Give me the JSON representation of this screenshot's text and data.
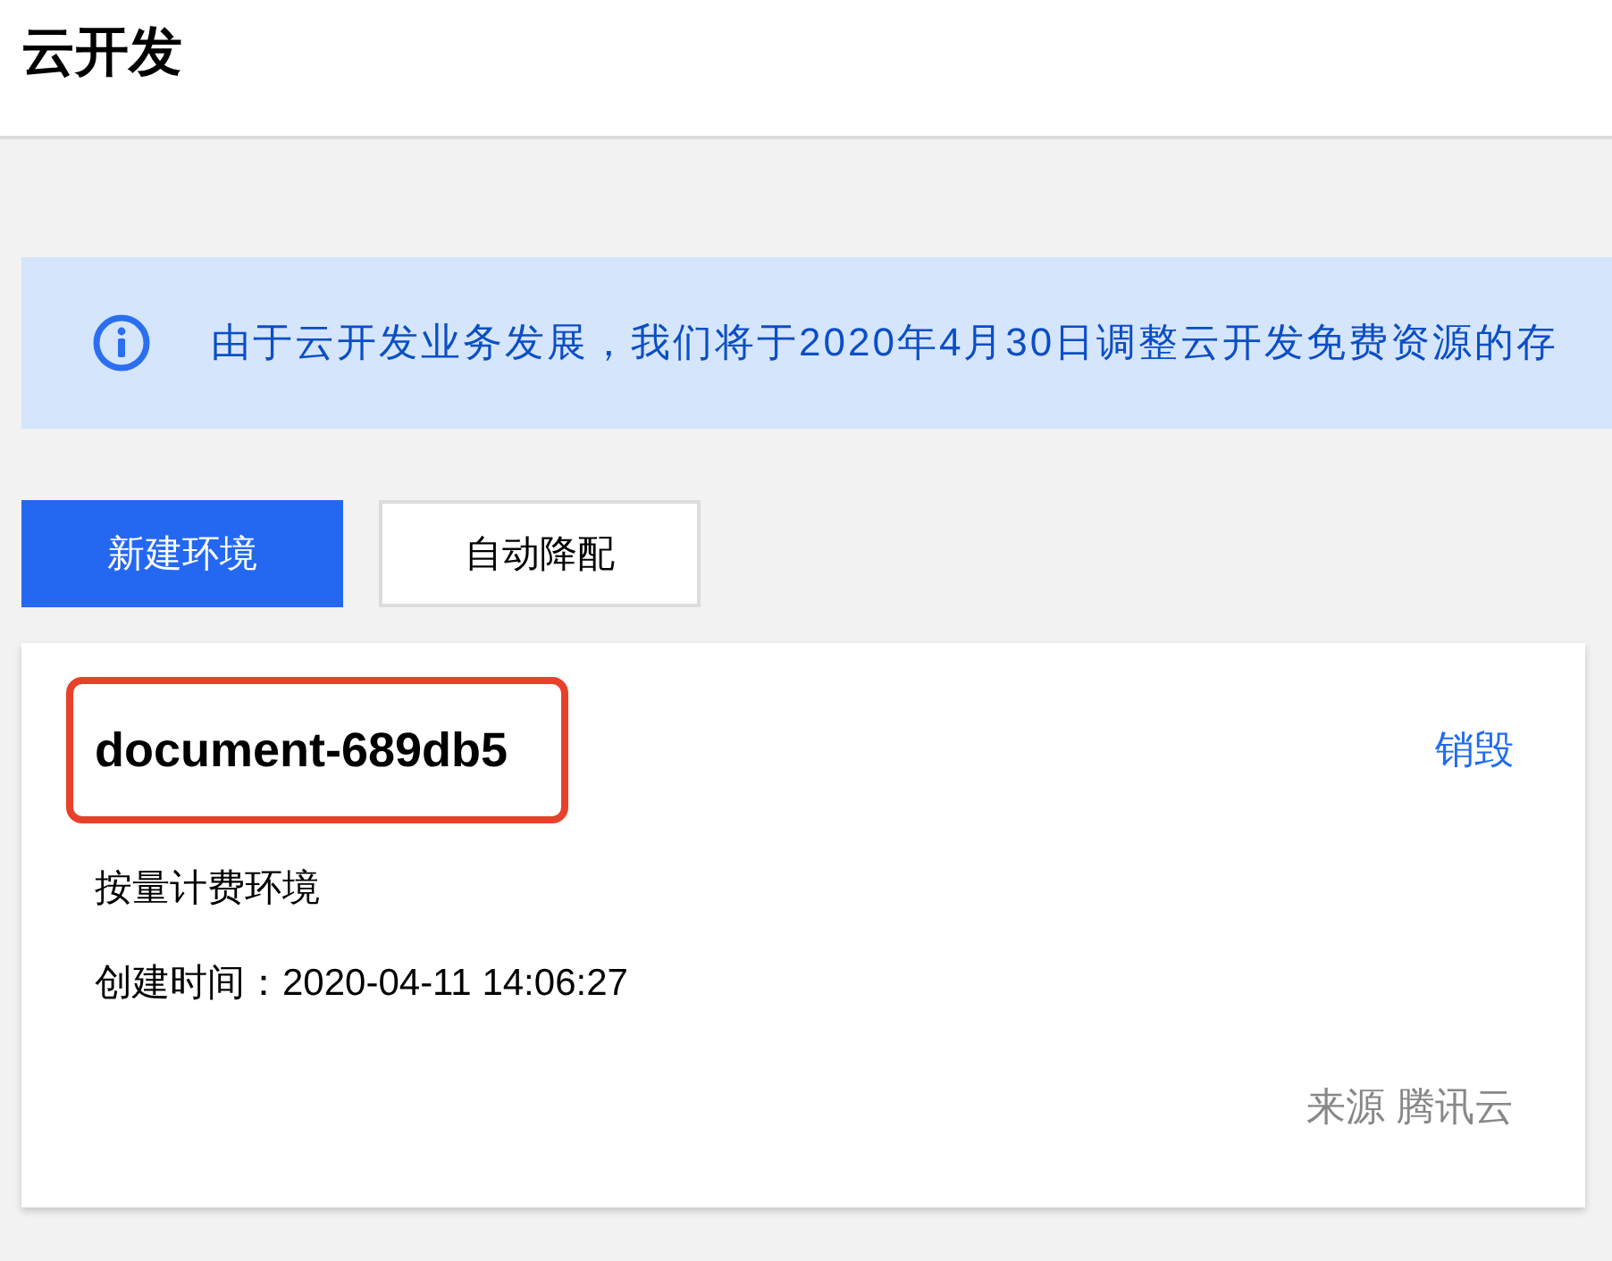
{
  "header": {
    "title": "云开发"
  },
  "notice": {
    "text": "由于云开发业务发展，我们将于2020年4月30日调整云开发免费资源的存"
  },
  "actions": [
    {
      "label": "新建环境",
      "kind": "primary"
    },
    {
      "label": "自动降配",
      "kind": "default"
    }
  ],
  "environments": [
    {
      "name": "document-689db5",
      "highlighted": true,
      "action": "销毁",
      "billing": "按量计费环境",
      "created": "创建时间：2020-04-11 14:06:27",
      "source": "来源 腾讯云"
    }
  ]
}
